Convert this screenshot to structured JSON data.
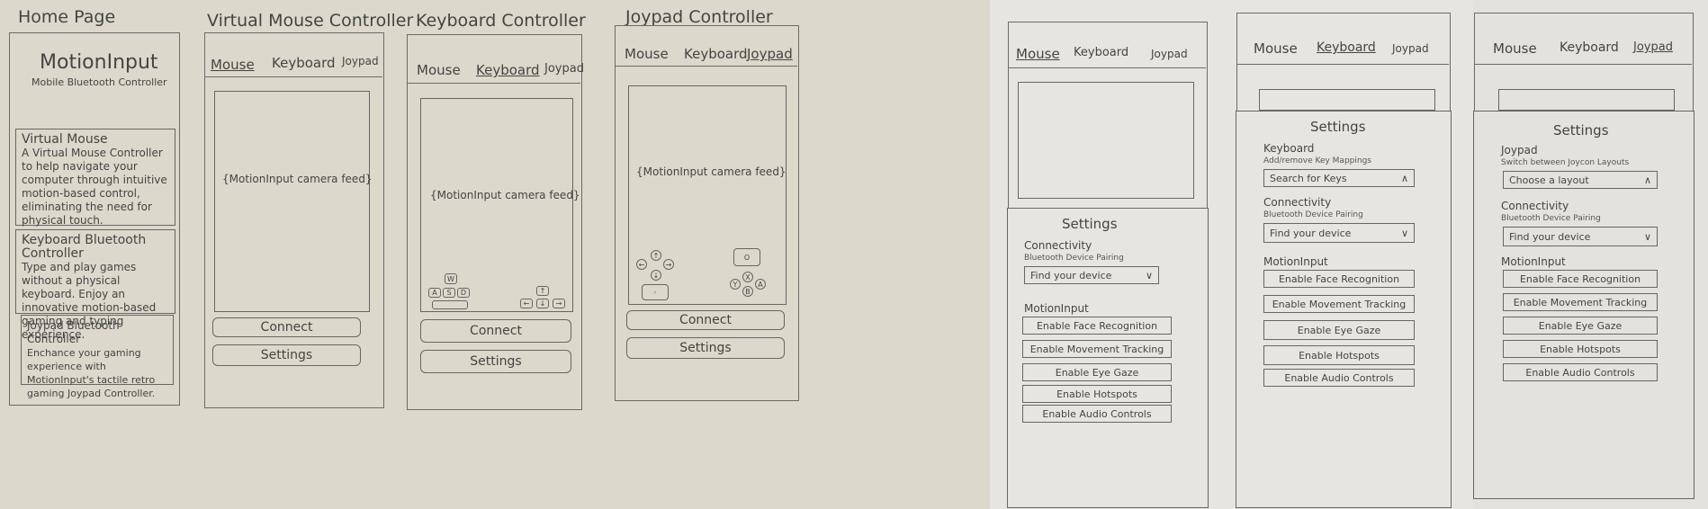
{
  "home": {
    "caption": "Home Page",
    "title": "MotionInput",
    "subtitle": "Mobile Bluetooth Controller",
    "cards": [
      {
        "title": "Virtual Mouse",
        "desc": "A Virtual Mouse Controller to help navigate your computer through intuitive motion-based control, eliminating the need for physical touch."
      },
      {
        "title": "Keyboard Bluetooth Controller",
        "desc": "Type and play games without a physical keyboard. Enjoy an innovative motion-based gaming and typing experience."
      },
      {
        "title": "Joypad Bluetooth Controller",
        "desc": "Enchance your gaming experience with MotionInput's tactile retro gaming Joypad Controller."
      }
    ]
  },
  "tabs": {
    "mouse": "Mouse",
    "keyboard": "Keyboard",
    "joypad": "Joypad"
  },
  "buttons": {
    "connect": "Connect",
    "settings": "Settings"
  },
  "feed": "{MotionInput camera feed}",
  "mouse_screen": {
    "caption": "Virtual Mouse Controller"
  },
  "keyboard_screen": {
    "caption": "Keyboard Controller",
    "keys": {
      "w": "W",
      "a": "A",
      "s": "S",
      "d": "D",
      "up": "↑",
      "left": "←",
      "down": "↓",
      "right": "→"
    }
  },
  "joypad_screen": {
    "caption": "Joypad Controller",
    "keys": {
      "up": "↑",
      "down": "↓",
      "left": "←",
      "right": "→",
      "o": "O",
      "x": "X",
      "y": "Y",
      "b": "B",
      "a": "A"
    }
  },
  "settings": {
    "title": "Settings",
    "connectivity": "Connectivity",
    "bt_pairing": "Bluetooth Device Pairing",
    "find_device": "Find your device",
    "keyboard_label": "Keyboard",
    "keyboard_sub": "Add/remove Key Mappings",
    "search_keys": "Search for Keys",
    "joypad_label": "Joypad",
    "joypad_sub": "Switch between Joycon Layouts",
    "choose_layout": "Choose a layout",
    "motioninput": "MotionInput",
    "options": [
      "Enable Face Recognition",
      "Enable Movement Tracking",
      "Enable Eye Gaze",
      "Enable Hotspots",
      "Enable Audio Controls"
    ],
    "chevron_down": "∨",
    "chevron_up": "∧"
  }
}
